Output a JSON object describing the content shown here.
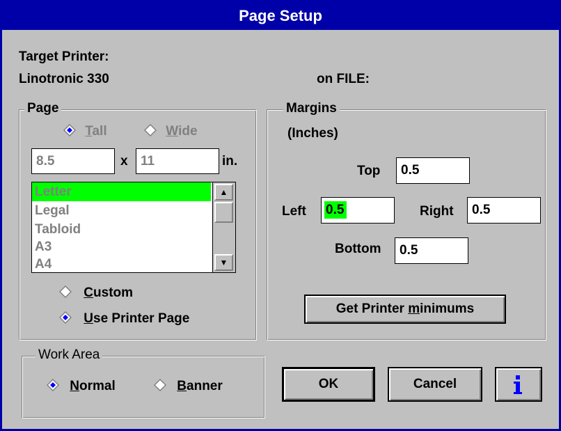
{
  "window": {
    "title": "Page Setup"
  },
  "target": {
    "heading": "Target Printer:",
    "printer": "Linotronic 330",
    "port": "on FILE:"
  },
  "page_group": {
    "legend": "Page",
    "orientation": {
      "tall": {
        "prefix": "",
        "mnemonic": "T",
        "rest": "all",
        "selected": true,
        "enabled": false
      },
      "wide": {
        "prefix": "",
        "mnemonic": "W",
        "rest": "ide",
        "selected": false,
        "enabled": false
      }
    },
    "width_value": "8.5",
    "times": "x",
    "height_value": "11",
    "unit": "in.",
    "sizes": [
      "Letter",
      "Legal",
      "Tabloid",
      "A3",
      "A4"
    ],
    "selected_size": "Letter",
    "custom": {
      "mnemonic": "C",
      "rest": "ustom",
      "selected": false
    },
    "use_printer_page": {
      "mnemonic": "U",
      "rest": "se Printer Page",
      "selected": true
    }
  },
  "margins_group": {
    "legend": "Margins",
    "units": "(Inches)",
    "top": {
      "label": "Top",
      "value": "0.5"
    },
    "left": {
      "label": "Left",
      "value": "0.5"
    },
    "right": {
      "label": "Right",
      "value": "0.5"
    },
    "bottom": {
      "label": "Bottom",
      "value": "0.5"
    },
    "minimums_button": {
      "prefix": "Get Printer ",
      "mnemonic": "m",
      "rest": "inimums"
    }
  },
  "work_area_group": {
    "legend": "Work Area",
    "normal": {
      "mnemonic": "N",
      "rest": "ormal",
      "selected": true
    },
    "banner": {
      "mnemonic": "B",
      "rest": "anner",
      "selected": false
    }
  },
  "buttons": {
    "ok": "OK",
    "cancel": "Cancel",
    "info_icon": "info-icon"
  },
  "colors": {
    "titlebar": "#0000a8",
    "face": "#c0c0c0",
    "highlight": "#00ff00",
    "radio_dot": "#0000ff"
  }
}
